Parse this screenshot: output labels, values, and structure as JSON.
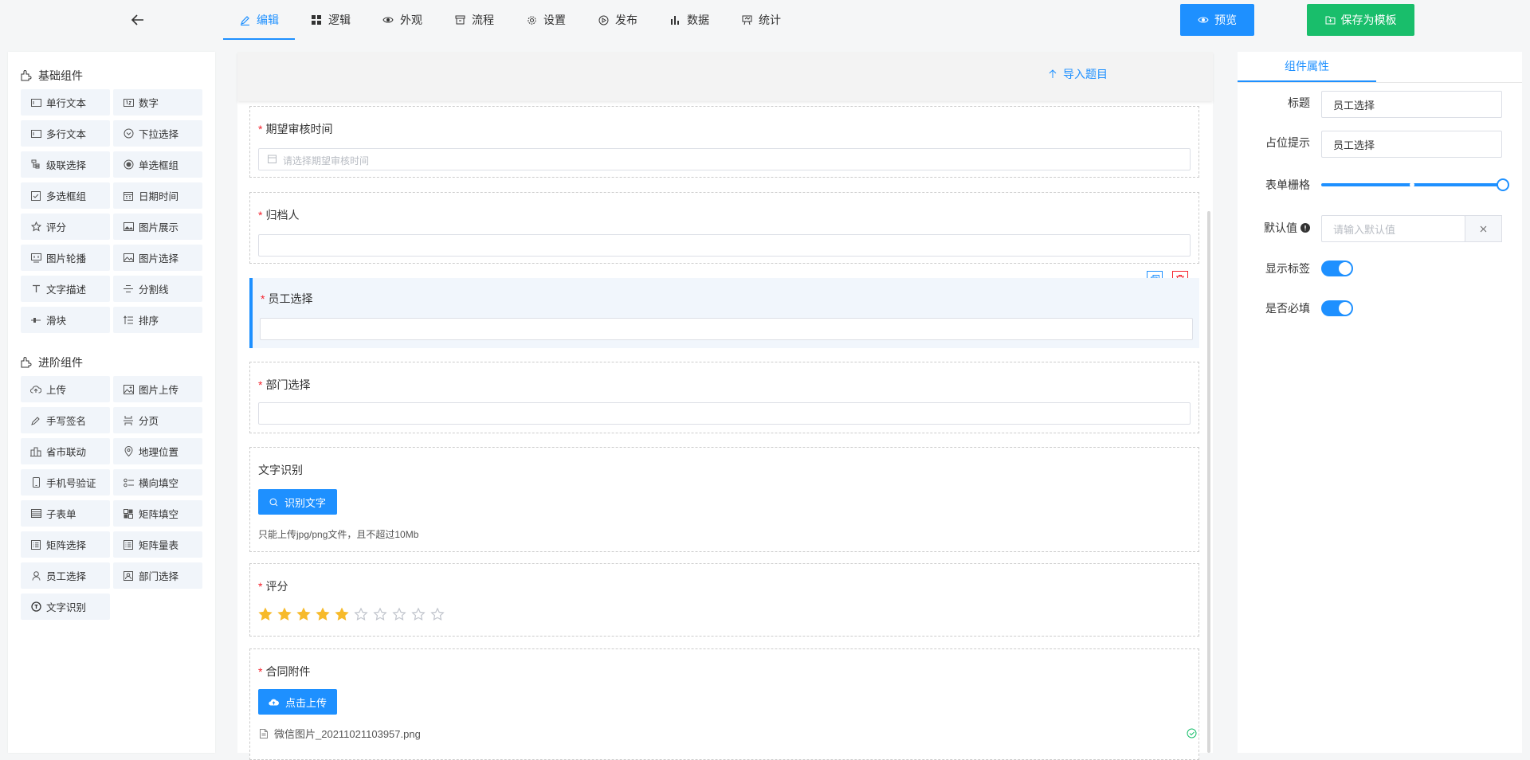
{
  "nav": {
    "tabs": [
      {
        "label": "编辑",
        "icon": "edit-icon"
      },
      {
        "label": "逻辑",
        "icon": "grid-icon"
      },
      {
        "label": "外观",
        "icon": "eye-icon"
      },
      {
        "label": "流程",
        "icon": "flow-icon"
      },
      {
        "label": "设置",
        "icon": "gear-icon"
      },
      {
        "label": "发布",
        "icon": "play-icon"
      },
      {
        "label": "数据",
        "icon": "bar-chart-icon"
      },
      {
        "label": "统计",
        "icon": "stats-icon"
      }
    ],
    "active_tab": "编辑",
    "preview_label": "预览",
    "save_template_label": "保存为模板"
  },
  "palette": {
    "basic_title": "基础组件",
    "basic_items": [
      "单行文本",
      "数字",
      "多行文本",
      "下拉选择",
      "级联选择",
      "单选框组",
      "多选框组",
      "日期时间",
      "评分",
      "图片展示",
      "图片轮播",
      "图片选择",
      "文字描述",
      "分割线",
      "滑块",
      "排序"
    ],
    "advanced_title": "进阶组件",
    "advanced_items": [
      "上传",
      "图片上传",
      "手写签名",
      "分页",
      "省市联动",
      "地理位置",
      "手机号验证",
      "横向填空",
      "子表单",
      "矩阵填空",
      "矩阵选择",
      "矩阵量表",
      "员工选择",
      "部门选择",
      "文字识别"
    ]
  },
  "canvas": {
    "import_label": "导入题目",
    "fields": {
      "review_time": {
        "label": "期望审核时间",
        "required": "*",
        "placeholder": "请选择期望审核时间"
      },
      "archiver": {
        "label": "归档人",
        "required": "*"
      },
      "employee": {
        "label": "员工选择",
        "required": "*"
      },
      "department": {
        "label": "部门选择",
        "required": "*"
      },
      "ocr": {
        "label": "文字识别",
        "button": "识别文字",
        "hint": "只能上传jpg/png文件，且不超过10Mb"
      },
      "rating": {
        "label": "评分",
        "required": "*",
        "value": 5,
        "max": 10
      },
      "attachment": {
        "label": "合同附件",
        "required": "*",
        "button": "点击上传",
        "file_name": "微信图片_20211021103957.png"
      }
    }
  },
  "props": {
    "tab_label": "组件属性",
    "title_label": "标题",
    "title_value": "员工选择",
    "placeholder_label": "占位提示",
    "placeholder_value": "员工选择",
    "grid_label": "表单栅格",
    "grid_value_fraction": 1.0,
    "default_label": "默认值",
    "default_placeholder": "请输入默认值",
    "show_label_label": "显示标签",
    "show_label_value": true,
    "required_label": "是否必填",
    "required_value": true
  },
  "colors": {
    "accent": "#1e90ff",
    "save": "#19be6b",
    "required": "#f5222d",
    "star": "#f7ba2a"
  }
}
